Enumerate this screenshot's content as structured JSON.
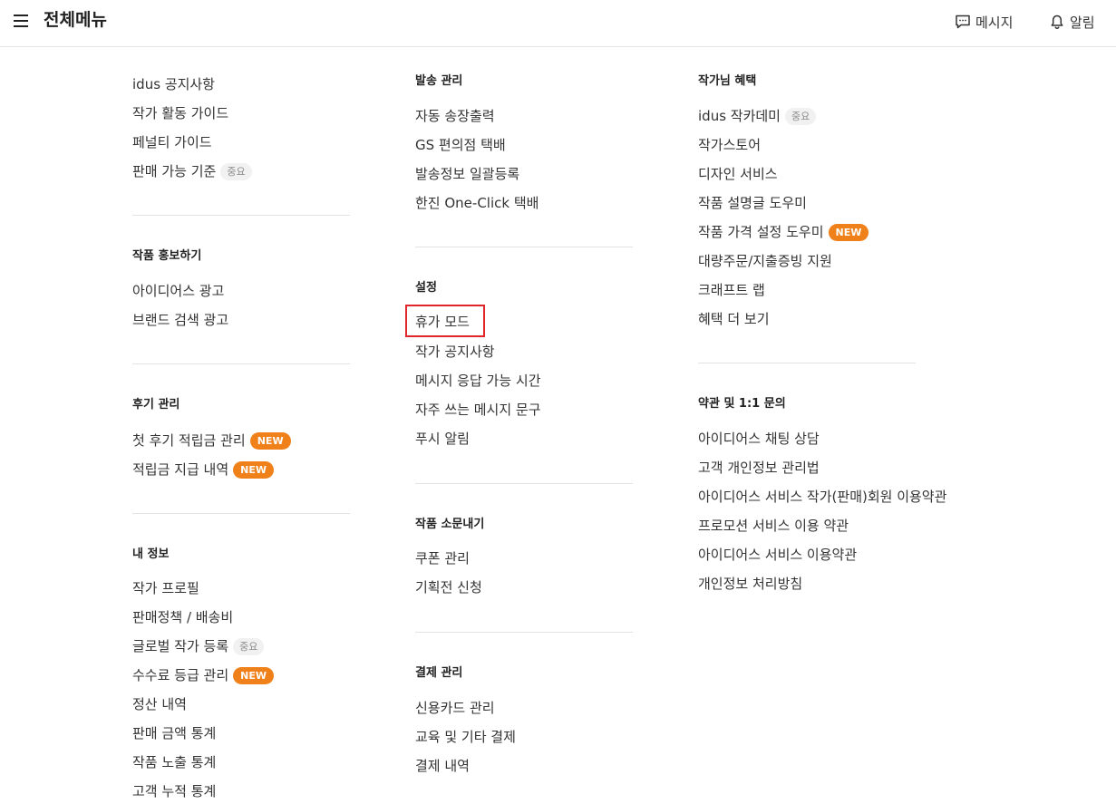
{
  "header": {
    "title": "전체메뉴",
    "message_label": "메시지",
    "alert_label": "알림"
  },
  "badges": {
    "important": "중요",
    "new": "NEW"
  },
  "col1": {
    "notice": [
      "idus 공지사항",
      "작가 활동 가이드",
      "페널티 가이드",
      "판매 가능 기준"
    ],
    "promo": {
      "title": "작품 홍보하기",
      "items": [
        "아이디어스 광고",
        "브랜드 검색 광고"
      ]
    },
    "review": {
      "title": "후기 관리",
      "items": [
        "첫 후기 적립금 관리",
        "적립금 지급 내역"
      ]
    },
    "myinfo": {
      "title": "내 정보",
      "items": [
        "작가 프로필",
        "판매정책 / 배송비",
        "글로벌 작가 등록",
        "수수료 등급 관리",
        "정산 내역",
        "판매 금액 통계",
        "작품 노출 통계",
        "고객 누적 통계"
      ]
    }
  },
  "col2": {
    "shipping": {
      "title": "발송 관리",
      "items": [
        "자동 송장출력",
        "GS 편의점 택배",
        "발송정보 일괄등록",
        "한진 One-Click 택배"
      ]
    },
    "settings": {
      "title": "설정",
      "items": [
        "휴가 모드",
        "작가 공지사항",
        "메시지 응답 가능 시간",
        "자주 쓰는 메시지 문구",
        "푸시 알림"
      ]
    },
    "marketing": {
      "title": "작품 소문내기",
      "items": [
        "쿠폰 관리",
        "기획전 신청"
      ]
    },
    "payment": {
      "title": "결제 관리",
      "items": [
        "신용카드 관리",
        "교육 및 기타 결제",
        "결제 내역"
      ]
    }
  },
  "col3": {
    "benefits": {
      "title": "작가님 혜택",
      "items": [
        "idus 작카데미",
        "작가스토어",
        "디자인 서비스",
        "작품 설명글 도우미",
        "작품 가격 설정 도우미",
        "대량주문/지출증빙 지원",
        "크래프트 랩",
        "혜택 더 보기"
      ]
    },
    "terms": {
      "title": "약관 및 1:1 문의",
      "items": [
        "아이디어스 채팅 상담",
        "고객 개인정보 관리법",
        "아이디어스 서비스 작가(판매)회원 이용약관",
        "프로모션 서비스 이용 약관",
        "아이디어스 서비스 이용약관",
        "개인정보 처리방침"
      ]
    }
  },
  "colors": {
    "new_badge": "#f08019",
    "highlight": "#e0262a"
  }
}
